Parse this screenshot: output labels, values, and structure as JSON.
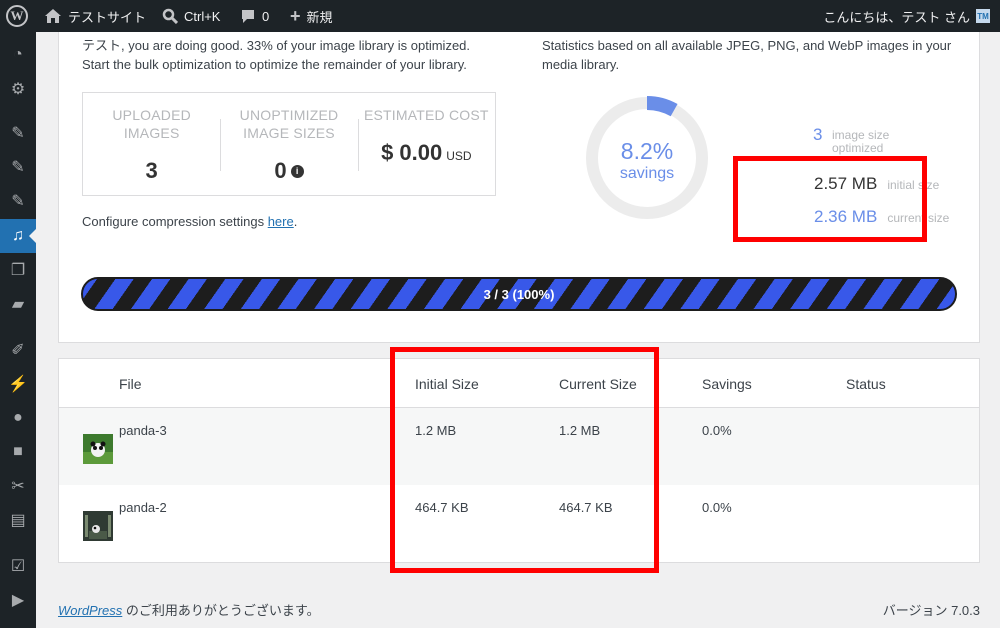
{
  "adminbar": {
    "site_name": "テストサイト",
    "search_shortcut": "Ctrl+K",
    "comment_count": "0",
    "new_label": "新規",
    "howdy": "こんにちは、テスト さん",
    "avatar_text": "TM"
  },
  "sidebar": {
    "items": [
      "dashboard-icon",
      "gear-icon",
      "pin-icon",
      "pin-icon",
      "pin-icon",
      "media-icon",
      "pages-icon",
      "comments-icon",
      "brush-icon",
      "plugin-icon",
      "user-icon",
      "lock-icon",
      "wrench-icon",
      "settings-icon",
      "check-icon",
      "play-icon"
    ]
  },
  "summary": {
    "line": "テスト, you are doing good. 33% of your image library is optimized. Start the bulk optimization to optimize the remainder of your library."
  },
  "stats_note": "Statistics based on all available JPEG, PNG, and WebP images in your media library.",
  "boxes": {
    "uploaded": {
      "caption": "UPLOADED IMAGES",
      "value": "3"
    },
    "unoptimized": {
      "caption": "UNOPTIMIZED IMAGE SIZES",
      "value": "0"
    },
    "cost": {
      "caption": "ESTIMATED COST",
      "value": "$ 0.00",
      "unit": "USD"
    }
  },
  "configure": {
    "text": "Configure compression settings ",
    "link": "here",
    "end": "."
  },
  "ring": {
    "percent": "8.2%",
    "label": "savings",
    "fraction": 0.082,
    "color": "#6a8ee8"
  },
  "optimized": {
    "count": "3",
    "label": "image size optimized"
  },
  "sizes": {
    "initial_value": "2.57 MB",
    "initial_label": "initial size",
    "current_value": "2.36 MB",
    "current_label": "current size"
  },
  "progress": {
    "label": "3 / 3 (100%)",
    "fraction": 1.0
  },
  "table": {
    "headers": {
      "file": "File",
      "initial": "Initial Size",
      "current": "Current Size",
      "savings": "Savings",
      "status": "Status"
    },
    "rows": [
      {
        "file": "panda-3",
        "initial": "1.2 MB",
        "current": "1.2 MB",
        "savings": "0.0%",
        "status": ""
      },
      {
        "file": "panda-2",
        "initial": "464.7 KB",
        "current": "464.7 KB",
        "savings": "0.0%",
        "status": ""
      }
    ]
  },
  "footer": {
    "wp_link": "WordPress",
    "thanks": " のご利用ありがとうございます。",
    "version": "バージョン 7.0.3"
  },
  "colors": {
    "accent": "#3858e9",
    "highlight": "#ff0000",
    "link": "#2271b1"
  }
}
